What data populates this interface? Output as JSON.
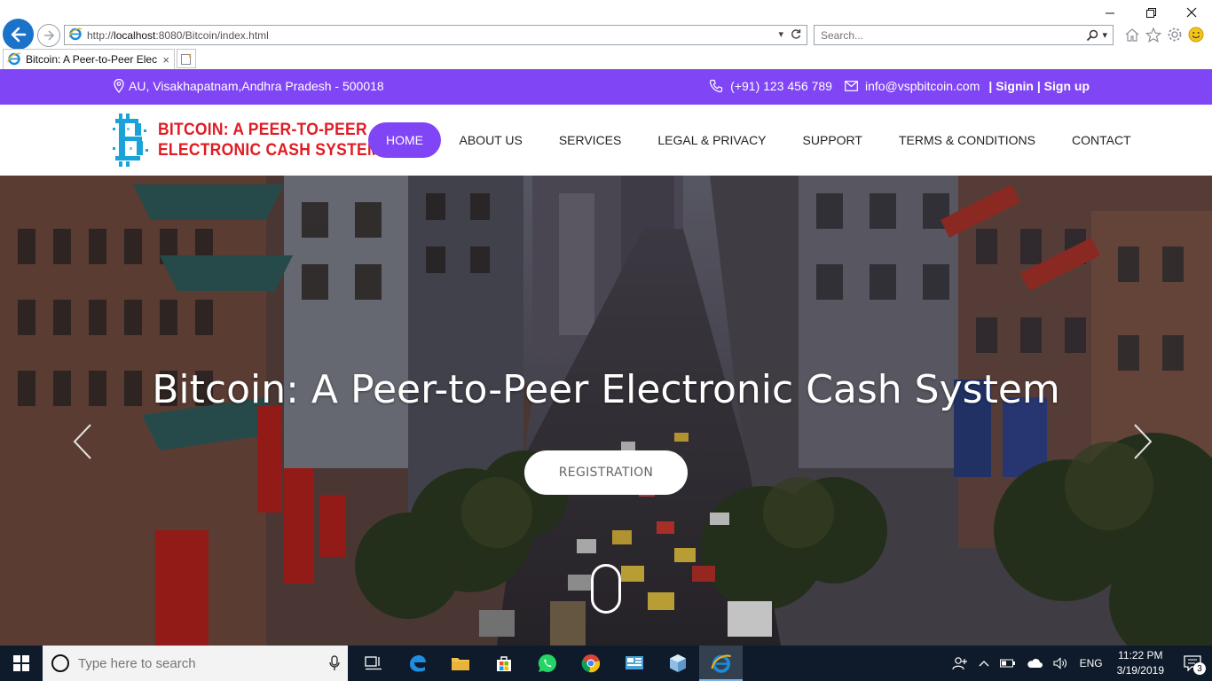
{
  "browser": {
    "url_prefix": "http://",
    "url_host": "localhost",
    "url_rest": ":8080/Bitcoin/index.html",
    "search_placeholder": "Search...",
    "tab_title": "Bitcoin: A Peer-to-Peer Elec...",
    "tab_close": "×"
  },
  "topbar": {
    "location": "AU, Visakhapatnam,Andhra Pradesh - 500018",
    "phone": "(+91) 123 456 789",
    "email": "info@vspbitcoin.com",
    "sep1": "|",
    "signin": "Signin",
    "sep2": "|",
    "signup": "Sign up"
  },
  "logo": {
    "letter": "B",
    "line1": "BITCOIN: A PEER-TO-PEER",
    "line2": "ELECTRONIC CASH SYSTEM"
  },
  "nav": {
    "items": [
      {
        "label": "HOME",
        "active": true
      },
      {
        "label": "ABOUT US"
      },
      {
        "label": "SERVICES"
      },
      {
        "label": "LEGAL & PRIVACY"
      },
      {
        "label": "SUPPORT"
      },
      {
        "label": "TERMS & CONDITIONS"
      },
      {
        "label": "CONTACT"
      }
    ]
  },
  "hero": {
    "title": "Bitcoin: A Peer-to-Peer Electronic Cash System",
    "button": "REGISTRATION"
  },
  "taskbar": {
    "search_placeholder": "Type here to search",
    "language": "ENG",
    "time": "11:22 PM",
    "date": "3/19/2019",
    "notifications": "3"
  },
  "colors": {
    "accent": "#8045f5",
    "logo_red": "#e01b24",
    "logo_blue": "#1aa3d9",
    "taskbar": "#0f1b2b"
  }
}
